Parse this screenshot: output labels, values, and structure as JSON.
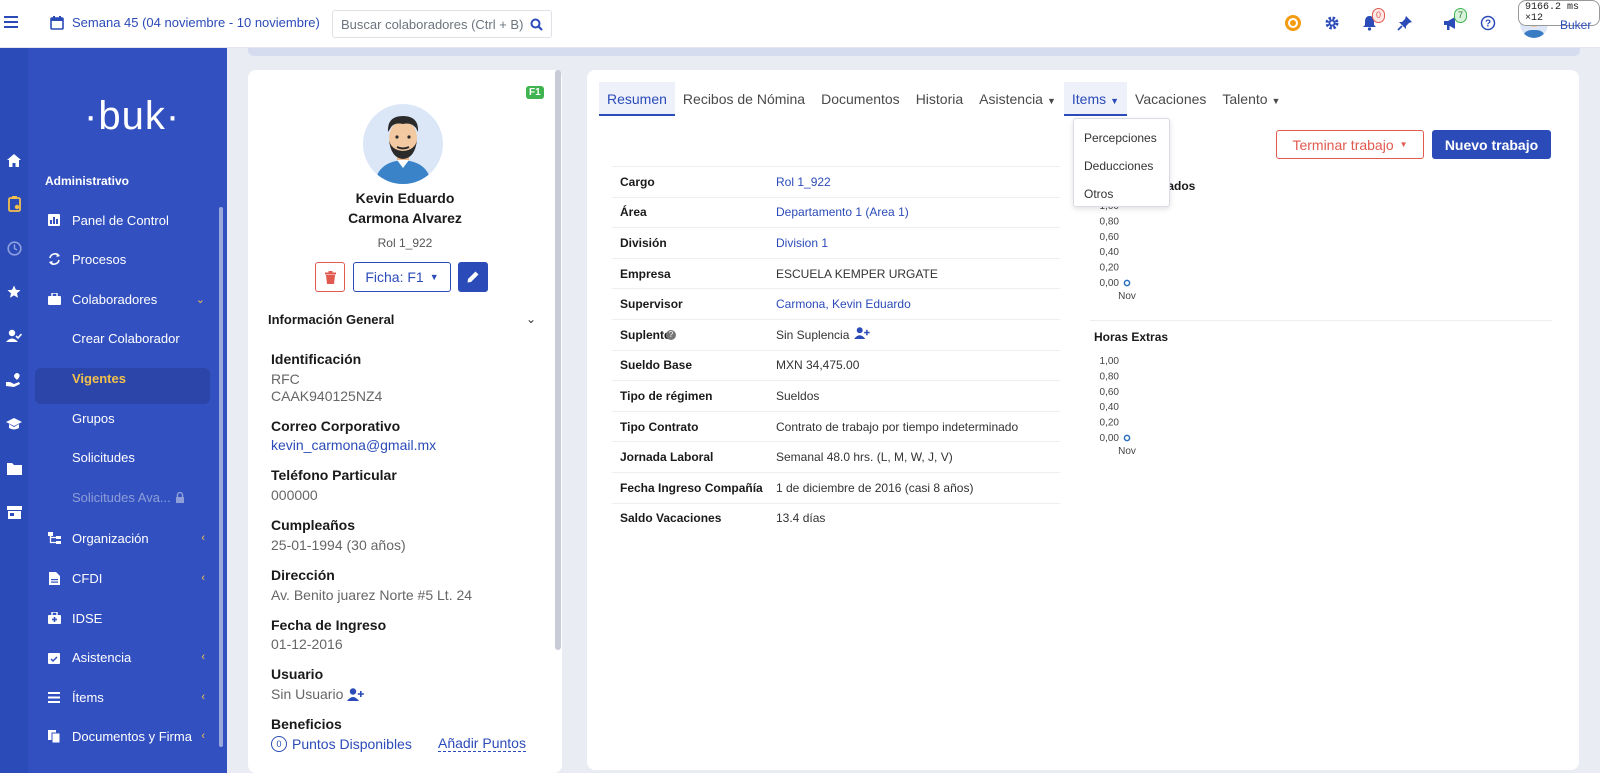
{
  "topbar": {
    "week": "Semana 45 (04 noviembre - 10 noviembre)",
    "search_placeholder": "Buscar colaboradores (Ctrl + B)",
    "notifications_count": "0",
    "announcements_count": "7",
    "timer": "9166.2 ms ×12",
    "user_name": "Buker"
  },
  "sidebar": {
    "logo": "·buk·",
    "section": "Administrativo",
    "items": [
      {
        "label": "Panel de Control"
      },
      {
        "label": "Procesos"
      },
      {
        "label": "Colaboradores"
      },
      {
        "label": "Organización"
      },
      {
        "label": "CFDI"
      },
      {
        "label": "IDSE"
      },
      {
        "label": "Asistencia"
      },
      {
        "label": "Ítems"
      },
      {
        "label": "Documentos y Firma"
      }
    ],
    "subitems": [
      {
        "label": "Crear Colaborador"
      },
      {
        "label": "Vigentes"
      },
      {
        "label": "Grupos"
      },
      {
        "label": "Solicitudes"
      },
      {
        "label": "Solicitudes Ava..."
      }
    ]
  },
  "profile": {
    "badge": "F1",
    "name_line1": "Kevin Eduardo",
    "name_line2": "Carmona Alvarez",
    "role": "Rol 1_922",
    "ficha_label": "Ficha: F1",
    "section_title": "Información General",
    "fields": [
      {
        "label": "Identificación",
        "value": "RFC",
        "value2": "CAAK940125NZ4"
      },
      {
        "label": "Correo Corporativo",
        "value": "kevin_carmona@gmail.mx"
      },
      {
        "label": "Teléfono Particular",
        "value": "000000"
      },
      {
        "label": "Cumpleaños",
        "value": "25-01-1994 (30 años)"
      },
      {
        "label": "Dirección",
        "value": "Av. Benito juarez Norte #5 Lt. 24"
      },
      {
        "label": "Fecha de Ingreso",
        "value": "01-12-2016"
      },
      {
        "label": "Usuario",
        "value": "Sin Usuario"
      },
      {
        "label": "Beneficios",
        "points": "0",
        "points_label": "Puntos Disponibles",
        "add_points": "Añadir Puntos"
      }
    ]
  },
  "tabs": [
    "Resumen",
    "Recibos de Nómina",
    "Documentos",
    "Historia",
    "Asistencia",
    "Items",
    "Vacaciones",
    "Talento"
  ],
  "items_dropdown": [
    "Percepciones",
    "Deducciones",
    "Otros"
  ],
  "actions": {
    "terminate": "Terminar trabajo",
    "new_job": "Nuevo trabajo"
  },
  "details": [
    {
      "label": "Cargo",
      "value": "Rol 1_922",
      "link": true
    },
    {
      "label": "Área",
      "value": "Departamento 1 (Area 1)",
      "link": true
    },
    {
      "label": "División",
      "value": "Division 1",
      "link": true
    },
    {
      "label": "Empresa",
      "value": "ESCUELA KEMPER URGATE",
      "link": false
    },
    {
      "label": "Supervisor",
      "value": "Carmona, Kevin Eduardo",
      "link": true
    },
    {
      "label": "Suplente",
      "value": "Sin Suplencia",
      "link": false
    },
    {
      "label": "Sueldo Base",
      "value": "MXN 34,475.00",
      "link": false
    },
    {
      "label": "Tipo de régimen",
      "value": "Sueldos",
      "link": false
    },
    {
      "label": "Tipo Contrato",
      "value": "Contrato de trabajo por tiempo indeterminado",
      "link": false
    },
    {
      "label": "Jornada Laboral",
      "value": "Semanal 48.0 hrs. (L, M, W, J, V)",
      "link": false
    },
    {
      "label": "Fecha Ingreso Compañía",
      "value": "1 de diciembre de 2016 (casi 8 años)",
      "link": false
    },
    {
      "label": "Saldo Vacaciones",
      "value": "13.4 días",
      "link": false
    }
  ],
  "chart_data": [
    {
      "type": "line",
      "title": "bajados",
      "categories": [
        "Nov"
      ],
      "y_ticks": [
        "1,00",
        "0,80",
        "0,60",
        "0,40",
        "0,20",
        "0,00"
      ],
      "ylim": [
        0,
        1
      ],
      "series": [
        {
          "values": [
            0
          ]
        }
      ]
    },
    {
      "type": "line",
      "title": "Horas Extras",
      "categories": [
        "Nov"
      ],
      "y_ticks": [
        "1,00",
        "0,80",
        "0,60",
        "0,40",
        "0,20",
        "0,00"
      ],
      "ylim": [
        0,
        1
      ],
      "series": [
        {
          "values": [
            0
          ]
        }
      ]
    }
  ],
  "colors": {
    "primary": "#2b4bb8",
    "danger": "#e05a4f",
    "accent": "#f3c04c",
    "success": "#3fb34f"
  }
}
